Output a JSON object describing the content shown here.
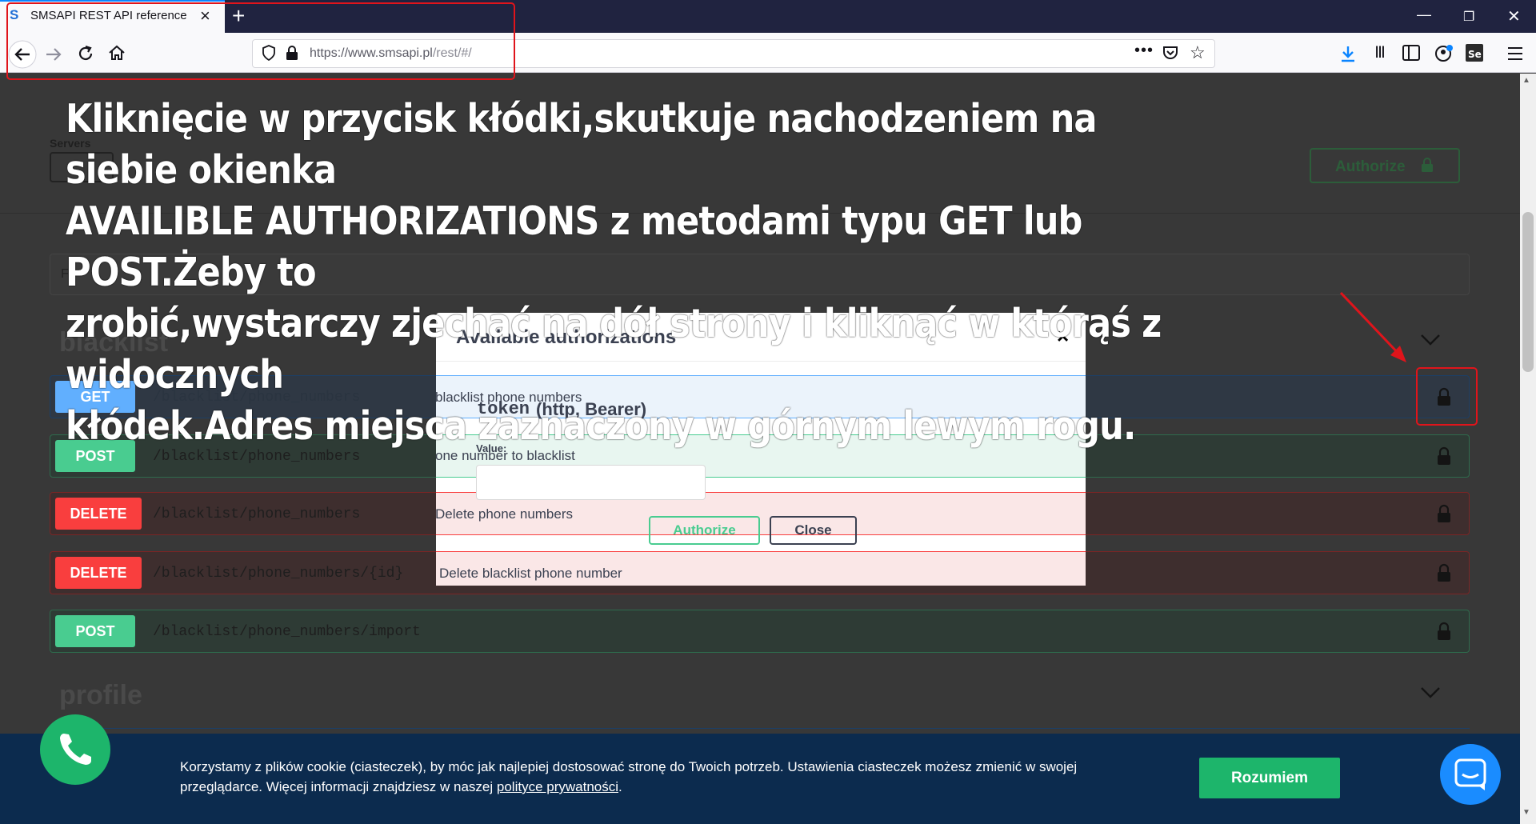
{
  "browser": {
    "tab_title": "SMSAPI REST API reference",
    "tab_favicon": "S",
    "new_tab": "+",
    "url_host": "https://www.smsapi.pl",
    "url_path": "/rest/#/"
  },
  "page": {
    "servers_label": "Servers",
    "authorize_label": "Authorize",
    "filter_first_char": "F",
    "section_blacklist": "blacklist",
    "section_profile": "profile",
    "operations": [
      {
        "method": "GET",
        "path": "/blacklist/phone_numbers",
        "summary": "blacklist phone numbers",
        "color": "#61affe"
      },
      {
        "method": "POST",
        "path": "/blacklist/phone_numbers",
        "summary": "one number to blacklist",
        "color": "#49cc90"
      },
      {
        "method": "DELETE",
        "path": "/blacklist/phone_numbers",
        "summary": "Delete phone numbers",
        "color": "#f93e3e"
      },
      {
        "method": "DELETE",
        "path": "/blacklist/phone_numbers/{id}",
        "summary": "Delete blacklist phone number",
        "color": "#f93e3e"
      },
      {
        "method": "POST",
        "path": "/blacklist/phone_numbers/import",
        "summary": "",
        "color": "#49cc90"
      }
    ]
  },
  "modal": {
    "title": "Available authorizations",
    "close_x": "×",
    "token_name": "token",
    "token_type": "(http, Bearer)",
    "value_label": "Value:",
    "value_input": "",
    "authorize_button": "Authorize",
    "close_button": "Close"
  },
  "annotation": {
    "lines": [
      "Kliknięcie w przycisk kłódki,skutkuje nachodzeniem na siebie okienka",
      "AVAILIBLE AUTHORIZATIONS z metodami typu GET lub POST.Żeby to",
      "zrobić,wystarczy zjechać na dół strony i kliknąć w którąś z widocznych",
      "kłódek.Adres miejsca zaznaczony w górnym lewym rogu."
    ]
  },
  "cookie": {
    "text_before": "Korzystamy z plików cookie (ciasteczek), by móc jak najlepiej dostosować stronę do Twoich potrzeb. Ustawienia ciasteczek możesz zmienić w swojej przeglądarce. Więcej informacji znajdziesz w naszej ",
    "link": "polityce prywatności",
    "text_after": ".",
    "button": "Rozumiem"
  },
  "colors": {
    "get": "#61affe",
    "post": "#49cc90",
    "delete": "#f93e3e",
    "annotation_red": "#e0141b",
    "cookie_bg": "#0c2b4e",
    "accent_green": "#1db56b"
  }
}
